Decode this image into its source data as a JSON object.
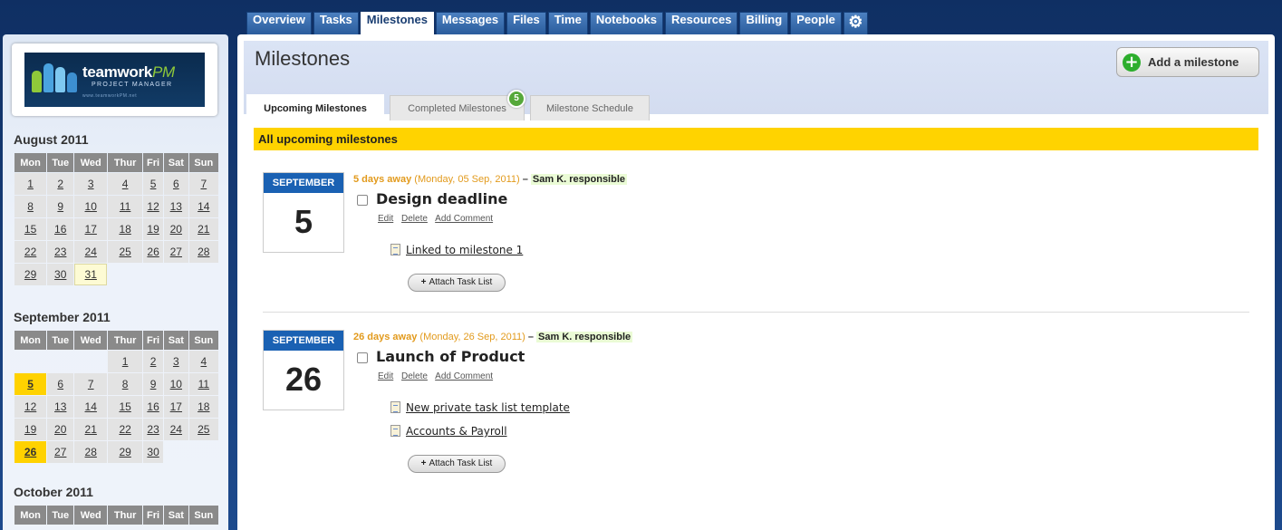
{
  "nav": {
    "tabs": [
      "Overview",
      "Tasks",
      "Milestones",
      "Messages",
      "Files",
      "Time",
      "Notebooks",
      "Resources",
      "Billing",
      "People"
    ],
    "active": "Milestones",
    "settings_icon": "gear-icon"
  },
  "logo": {
    "brand": "teamwork",
    "brand_accent": "PM",
    "subtitle": "PROJECT MANAGER",
    "url": "www.teamworkPM.net"
  },
  "calendars": [
    {
      "title": "August 2011",
      "days": [
        "Mon",
        "Tue",
        "Wed",
        "Thur",
        "Fri",
        "Sat",
        "Sun"
      ],
      "weeks": [
        [
          "1",
          "2",
          "3",
          "4",
          "5",
          "6",
          "7"
        ],
        [
          "8",
          "9",
          "10",
          "11",
          "12",
          "13",
          "14"
        ],
        [
          "15",
          "16",
          "17",
          "18",
          "19",
          "20",
          "21"
        ],
        [
          "22",
          "23",
          "24",
          "25",
          "26",
          "27",
          "28"
        ],
        [
          "29",
          "30",
          "31",
          "",
          "",
          "",
          ""
        ]
      ],
      "today": "31",
      "milestone_days": []
    },
    {
      "title": "September 2011",
      "days": [
        "Mon",
        "Tue",
        "Wed",
        "Thur",
        "Fri",
        "Sat",
        "Sun"
      ],
      "weeks": [
        [
          "",
          "",
          "",
          "1",
          "2",
          "3",
          "4"
        ],
        [
          "5",
          "6",
          "7",
          "8",
          "9",
          "10",
          "11"
        ],
        [
          "12",
          "13",
          "14",
          "15",
          "16",
          "17",
          "18"
        ],
        [
          "19",
          "20",
          "21",
          "22",
          "23",
          "24",
          "25"
        ],
        [
          "26",
          "27",
          "28",
          "29",
          "30",
          "",
          ""
        ]
      ],
      "today": "",
      "milestone_days": [
        "5",
        "26"
      ]
    },
    {
      "title": "October 2011",
      "days": [
        "Mon",
        "Tue",
        "Wed",
        "Thur",
        "Fri",
        "Sat",
        "Sun"
      ],
      "weeks": [],
      "today": "",
      "milestone_days": []
    }
  ],
  "main": {
    "title": "Milestones",
    "add_button": "Add a milestone",
    "tabs": [
      "Upcoming Milestones",
      "Completed Milestones",
      "Milestone Schedule"
    ],
    "completed_count": "5",
    "section_title": "All upcoming milestones",
    "milestones": [
      {
        "month": "SEPTEMBER",
        "day": "5",
        "away": "5 days away",
        "date": "(Monday, 05 Sep, 2011)",
        "responsible": "Sam K. responsible",
        "title": "Design deadline",
        "actions": [
          "Edit",
          "Delete",
          "Add Comment"
        ],
        "task_lists": [
          "Linked to milestone 1"
        ],
        "attach_label": "Attach Task List"
      },
      {
        "month": "SEPTEMBER",
        "day": "26",
        "away": "26 days away",
        "date": "(Monday, 26 Sep, 2011)",
        "responsible": "Sam K. responsible",
        "title": "Launch of Product",
        "actions": [
          "Edit",
          "Delete",
          "Add Comment"
        ],
        "task_lists": [
          "New private task list template",
          "Accounts & Payroll"
        ],
        "attach_label": "Attach Task List"
      }
    ]
  },
  "colors": {
    "nav_bg": "#1d4a8d",
    "accent_yellow": "#ffd300",
    "calendar_blue": "#1a61b3",
    "green": "#2dae2d"
  }
}
